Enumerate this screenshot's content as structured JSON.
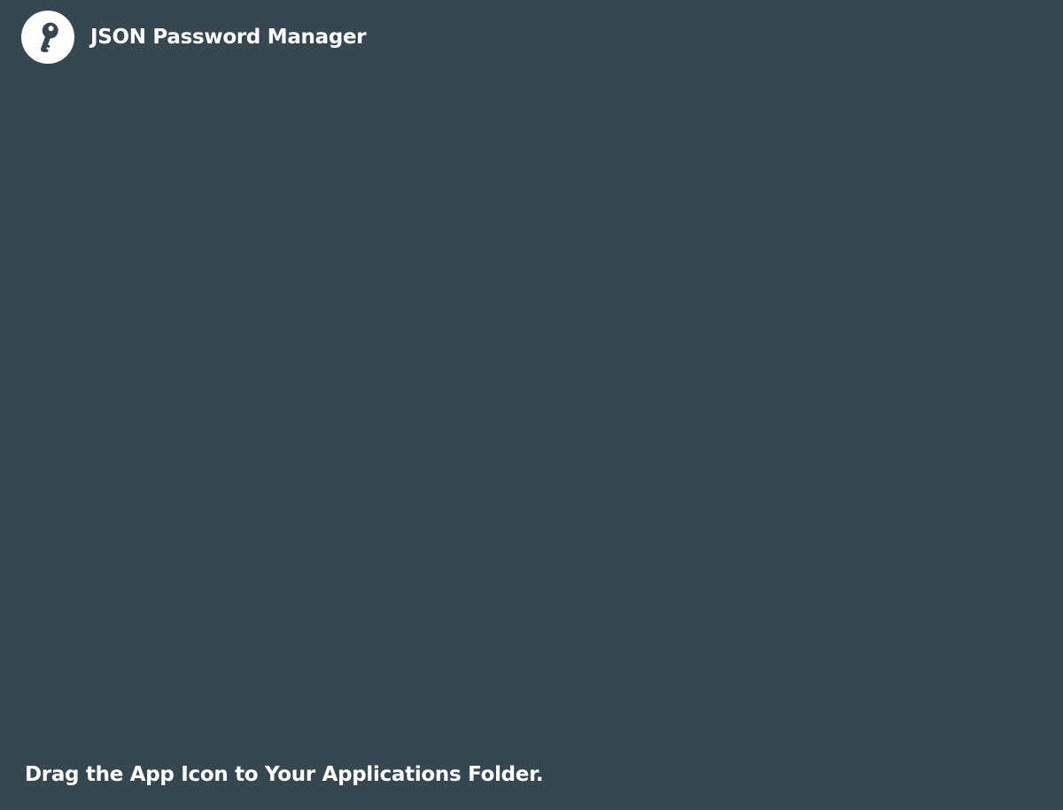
{
  "app": {
    "title": "JSON Password Manager",
    "icon": "key-icon"
  },
  "footer": {
    "instruction": "Drag the App Icon to Your Applications Folder."
  },
  "colors": {
    "background": "#37474f",
    "icon_background": "#ffffff",
    "icon_glyph": "#37474f",
    "text": "#ffffff"
  }
}
